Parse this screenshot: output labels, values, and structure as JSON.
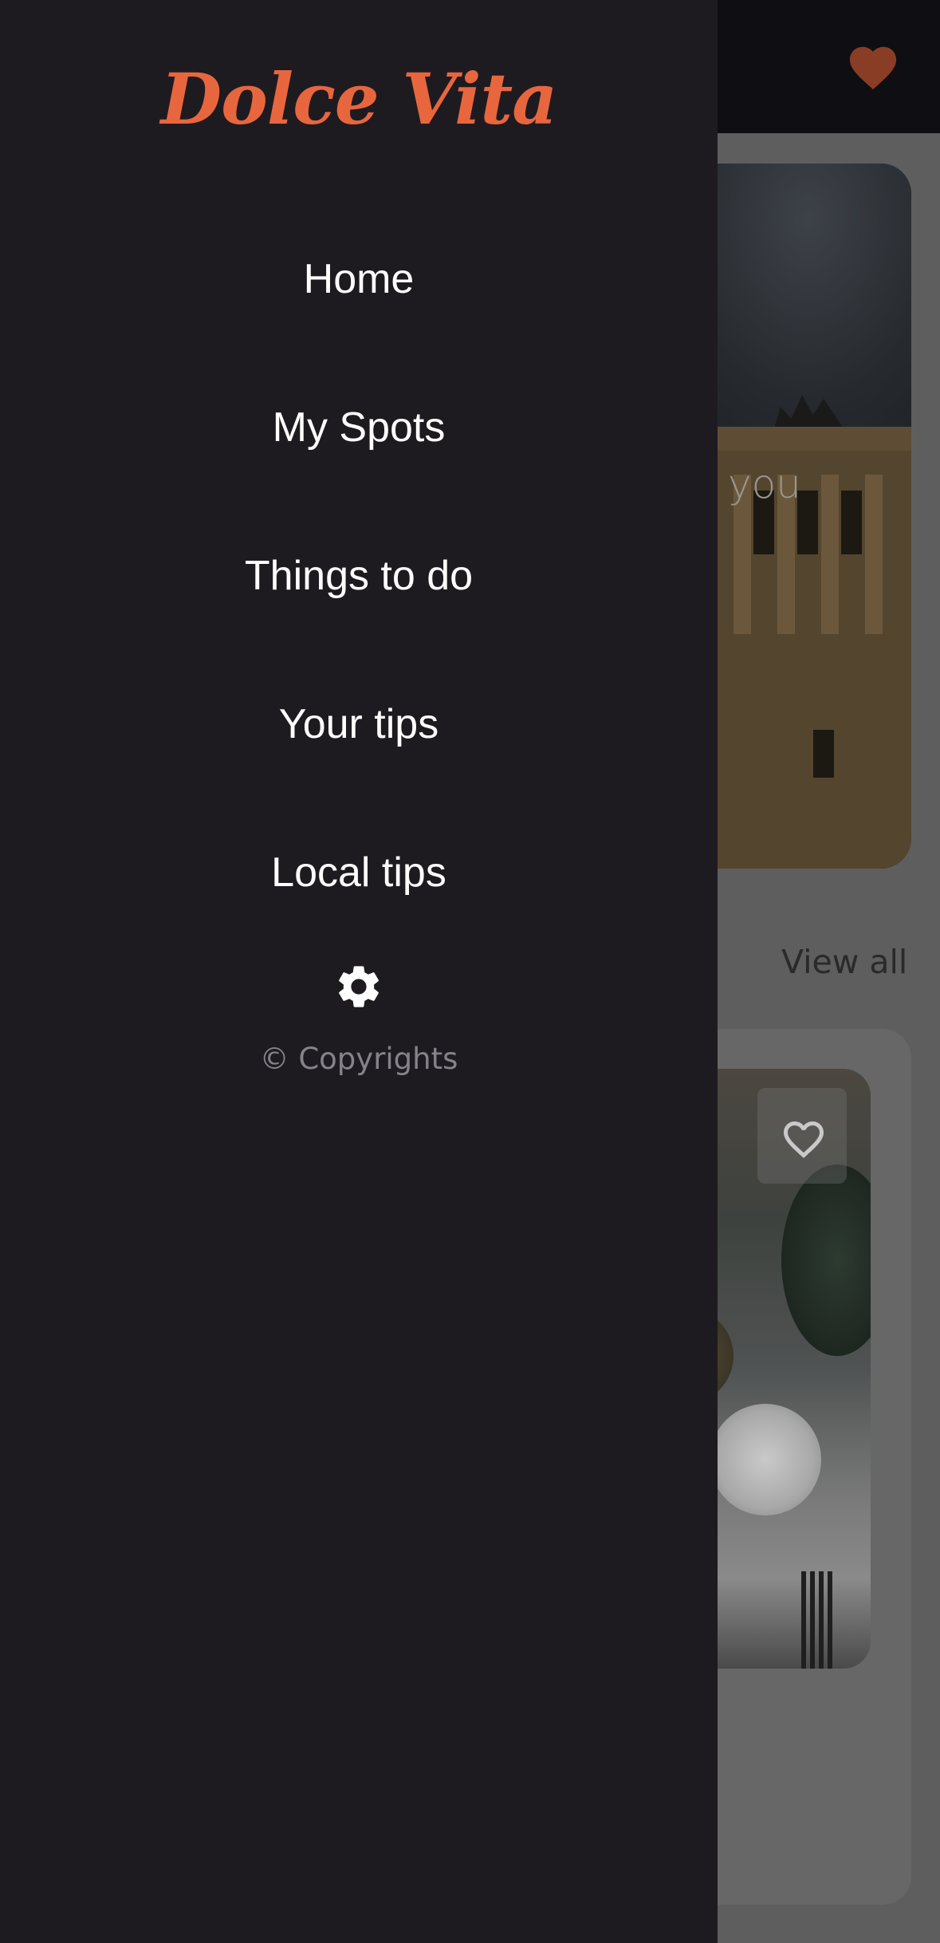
{
  "background": {
    "hero_text": "you",
    "view_all_label": "View all",
    "accent_color": "#e8663e"
  },
  "drawer": {
    "brand": "Dolce Vita",
    "items": [
      {
        "label": "Home"
      },
      {
        "label": "My Spots"
      },
      {
        "label": "Things to do"
      },
      {
        "label": "Your tips"
      },
      {
        "label": "Local tips"
      }
    ],
    "settings_icon": "gear-icon",
    "copyright": "© Copyrights"
  }
}
